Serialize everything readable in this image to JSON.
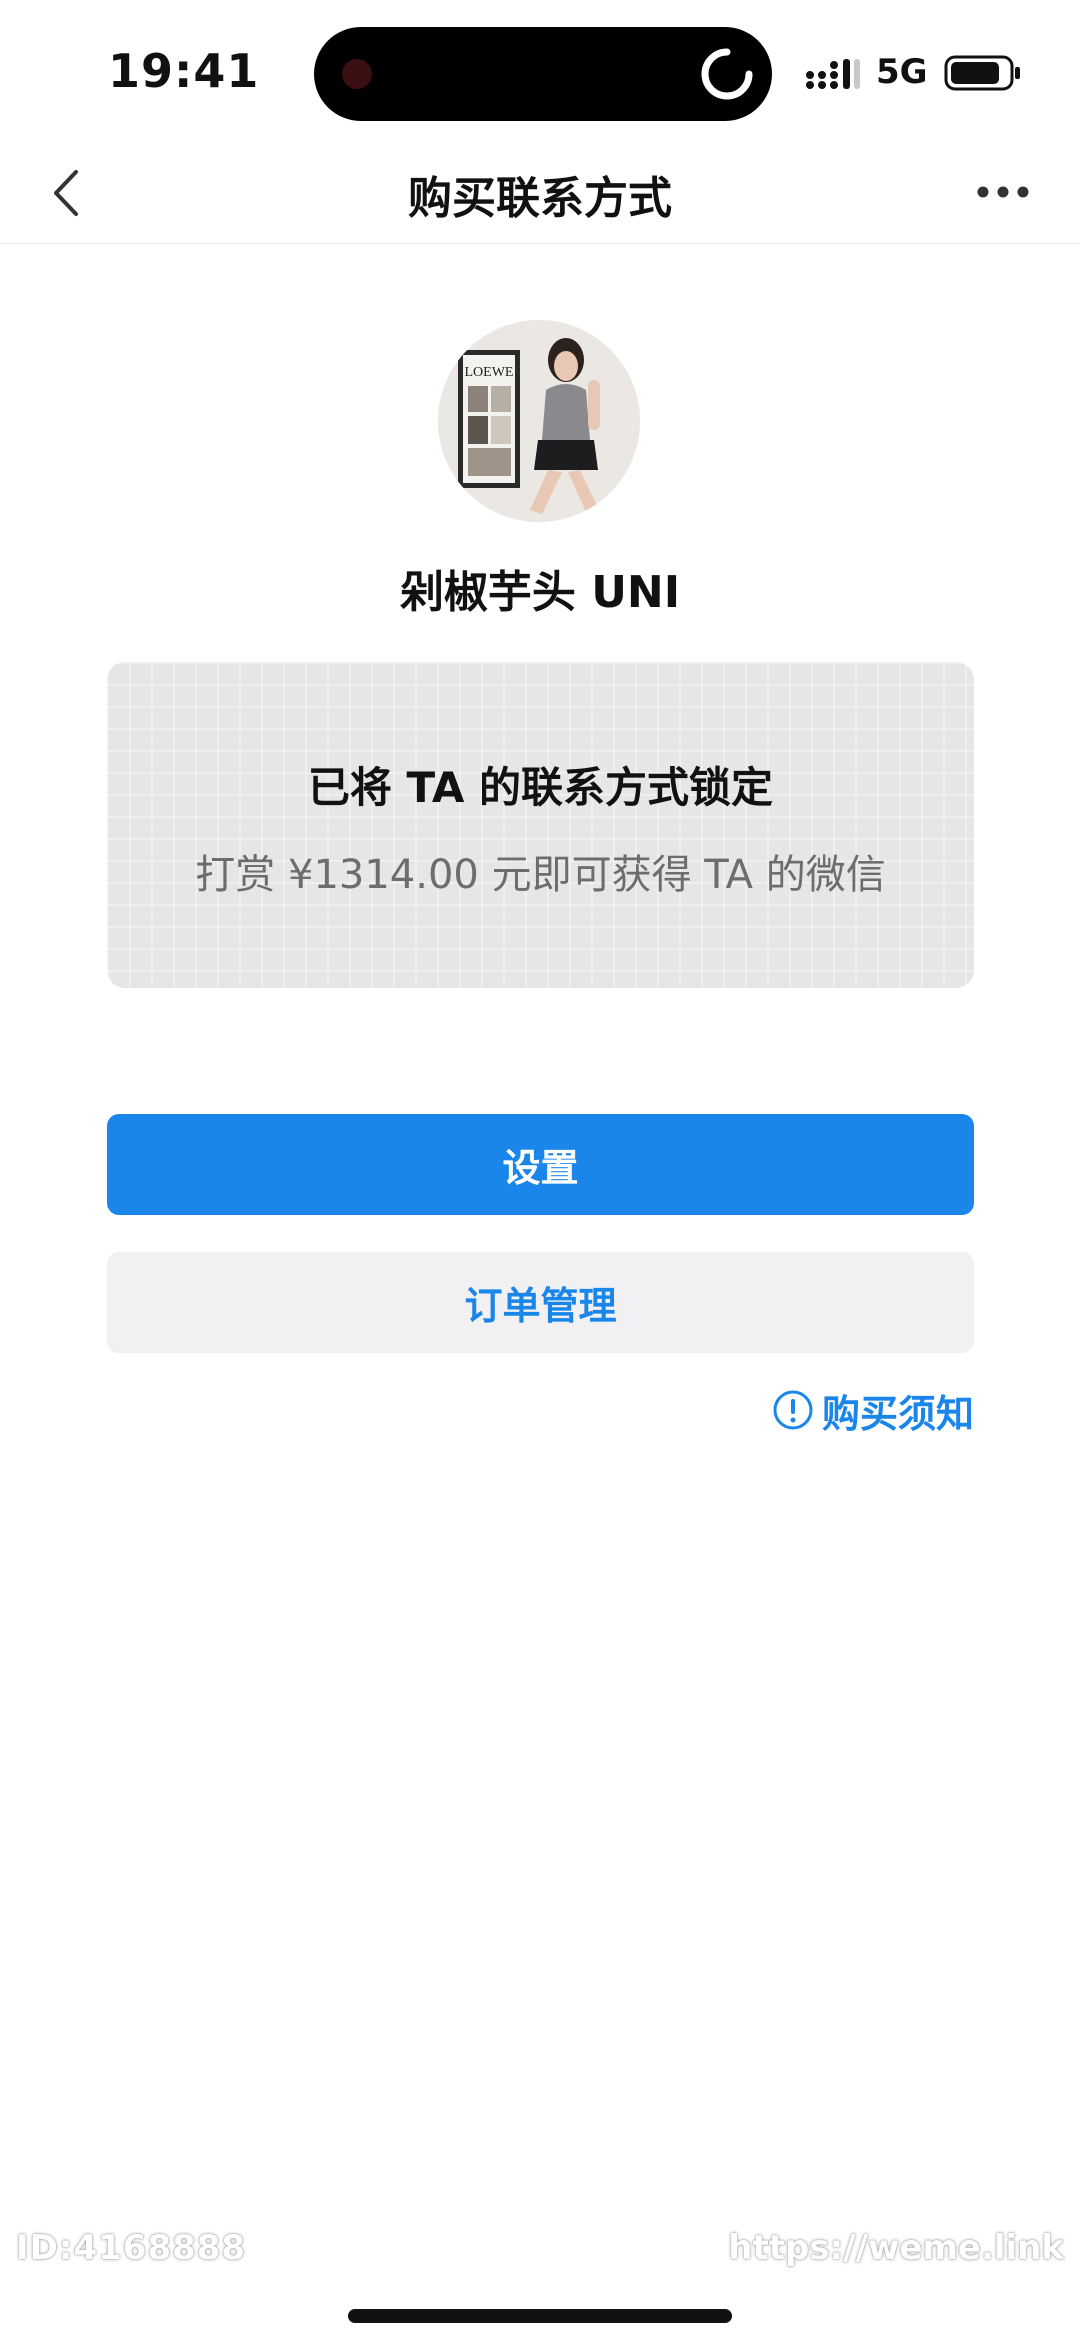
{
  "status_bar": {
    "time": "19:41",
    "network": "5G"
  },
  "nav": {
    "title": "购买联系方式",
    "back_icon": "chevron-left-icon",
    "more_icon": "more-horizontal-icon"
  },
  "profile": {
    "username": "剁椒芋头 UNI",
    "avatar_badge_text": "LOEWE"
  },
  "lock_card": {
    "title": "已将 TA 的联系方式锁定",
    "description": "打赏 ¥1314.00 元即可获得 TA 的微信"
  },
  "actions": {
    "primary_label": "设置",
    "secondary_label": "订单管理",
    "notice_label": "购买须知",
    "notice_icon": "info-circle-icon"
  },
  "watermarks": {
    "id": "ID:4168888",
    "url": "https://weme.link"
  },
  "colors": {
    "accent": "#1a86ea",
    "card_background": "#e6e6e6",
    "secondary_button": "#f1f1f3"
  }
}
